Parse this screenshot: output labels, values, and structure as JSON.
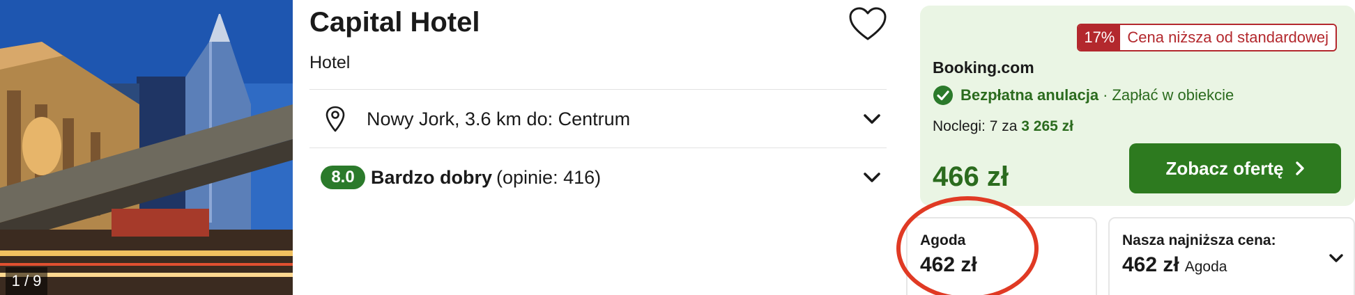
{
  "gallery": {
    "counter": "1 / 9"
  },
  "hotel": {
    "name": "Capital Hotel",
    "type": "Hotel",
    "location": "Nowy Jork, 3.6 km do: Centrum",
    "rating": {
      "score": "8.0",
      "label": "Bardzo dobry",
      "reviews": "(opinie: 416)"
    }
  },
  "offer": {
    "discount_pct": "17%",
    "discount_text": "Cena niższa od standardowej",
    "provider": "Booking.com",
    "free_cancellation": "Bezpłatna anulacja",
    "separator": "·",
    "pay_at_property": "Zapłać w obiekcie",
    "nights_prefix": "Noclegi: 7 za",
    "nights_total": "3 265 zł",
    "price": "466 zł",
    "cta_label": "Zobacz ofertę"
  },
  "alt_prices": {
    "agoda": {
      "label": "Agoda",
      "price": "462 zł"
    },
    "lowest": {
      "label": "Nasza najniższa cena:",
      "price": "462 zł",
      "provider": "Agoda"
    }
  },
  "icons": {
    "favorite": "heart-outline-icon",
    "location": "map-pin-icon",
    "expand": "chevron-down-icon",
    "check": "check-circle-icon",
    "cta": "chevron-right-icon"
  },
  "colors": {
    "brand_green": "#2d7a1f",
    "offer_bg": "#eaf5e4",
    "discount_red": "#b3282d",
    "highlight_circle": "#e03a24"
  }
}
